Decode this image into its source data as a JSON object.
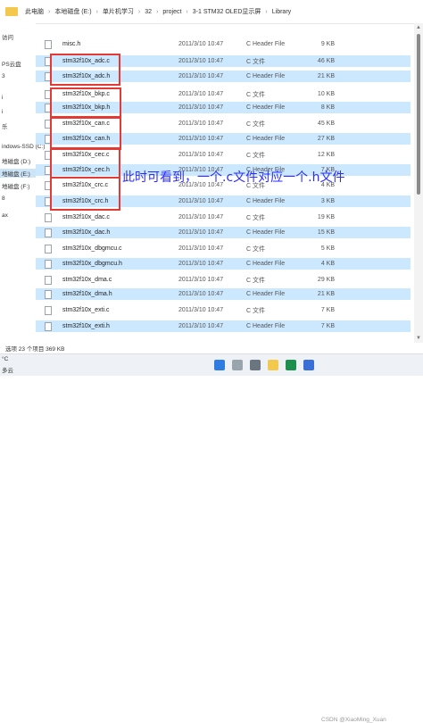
{
  "breadcrumb": [
    "此电脑",
    "本地磁盘 (E:)",
    "单片机学习",
    "32",
    "project",
    "3-1 STM32 OLED显示屏",
    "Library"
  ],
  "sidebar": [
    {
      "label": "访问"
    },
    {
      "label": "PS云盘"
    },
    {
      "label": "3"
    },
    {
      "label": "i"
    },
    {
      "label": "i"
    },
    {
      "label": "乐"
    },
    {
      "label": "indows-SSD (C:)"
    },
    {
      "label": "地磁盘 (D:)"
    },
    {
      "label": "地磁盘 (E:)"
    },
    {
      "label": "地磁盘 (F:)"
    },
    {
      "label": "8"
    },
    {
      "label": "ax"
    }
  ],
  "files": [
    {
      "name": "misc.h",
      "date": "2011/3/10 10:47",
      "type": "C Header File",
      "size": "9 KB"
    },
    {
      "name": "stm32f10x_adc.c",
      "date": "2011/3/10 10:47",
      "type": "C 文件",
      "size": "46 KB"
    },
    {
      "name": "stm32f10x_adc.h",
      "date": "2011/3/10 10:47",
      "type": "C Header File",
      "size": "21 KB"
    },
    {
      "name": "stm32f10x_bkp.c",
      "date": "2011/3/10 10:47",
      "type": "C 文件",
      "size": "10 KB"
    },
    {
      "name": "stm32f10x_bkp.h",
      "date": "2011/3/10 10:47",
      "type": "C Header File",
      "size": "8 KB"
    },
    {
      "name": "stm32f10x_can.c",
      "date": "2011/3/10 10:47",
      "type": "C 文件",
      "size": "45 KB"
    },
    {
      "name": "stm32f10x_can.h",
      "date": "2011/3/10 10:47",
      "type": "C Header File",
      "size": "27 KB"
    },
    {
      "name": "stm32f10x_cec.c",
      "date": "2011/3/10 10:47",
      "type": "C 文件",
      "size": "12 KB"
    },
    {
      "name": "stm32f10x_cec.h",
      "date": "2011/3/10 10:47",
      "type": "C Header File",
      "size": "7 KB"
    },
    {
      "name": "stm32f10x_crc.c",
      "date": "2011/3/10 10:47",
      "type": "C 文件",
      "size": "4 KB"
    },
    {
      "name": "stm32f10x_crc.h",
      "date": "2011/3/10 10:47",
      "type": "C Header File",
      "size": "3 KB"
    },
    {
      "name": "stm32f10x_dac.c",
      "date": "2011/3/10 10:47",
      "type": "C 文件",
      "size": "19 KB"
    },
    {
      "name": "stm32f10x_dac.h",
      "date": "2011/3/10 10:47",
      "type": "C Header File",
      "size": "15 KB"
    },
    {
      "name": "stm32f10x_dbgmcu.c",
      "date": "2011/3/10 10:47",
      "type": "C 文件",
      "size": "5 KB"
    },
    {
      "name": "stm32f10x_dbgmcu.h",
      "date": "2011/3/10 10:47",
      "type": "C Header File",
      "size": "4 KB"
    },
    {
      "name": "stm32f10x_dma.c",
      "date": "2011/3/10 10:47",
      "type": "C 文件",
      "size": "29 KB"
    },
    {
      "name": "stm32f10x_dma.h",
      "date": "2011/3/10 10:47",
      "type": "C Header File",
      "size": "21 KB"
    },
    {
      "name": "stm32f10x_exti.c",
      "date": "2011/3/10 10:47",
      "type": "C 文件",
      "size": "7 KB"
    },
    {
      "name": "stm32f10x_exti.h",
      "date": "2011/3/10 10:47",
      "type": "C Header File",
      "size": "7 KB"
    }
  ],
  "annotation": "此时可看到，一个.c文件对应一个.h文件",
  "status": "选项 23 个项目  369 KB",
  "taskbar": {
    "temp": "°C",
    "weather": "多云"
  },
  "watermark": "CSDN @XiaoMing_Xuan"
}
